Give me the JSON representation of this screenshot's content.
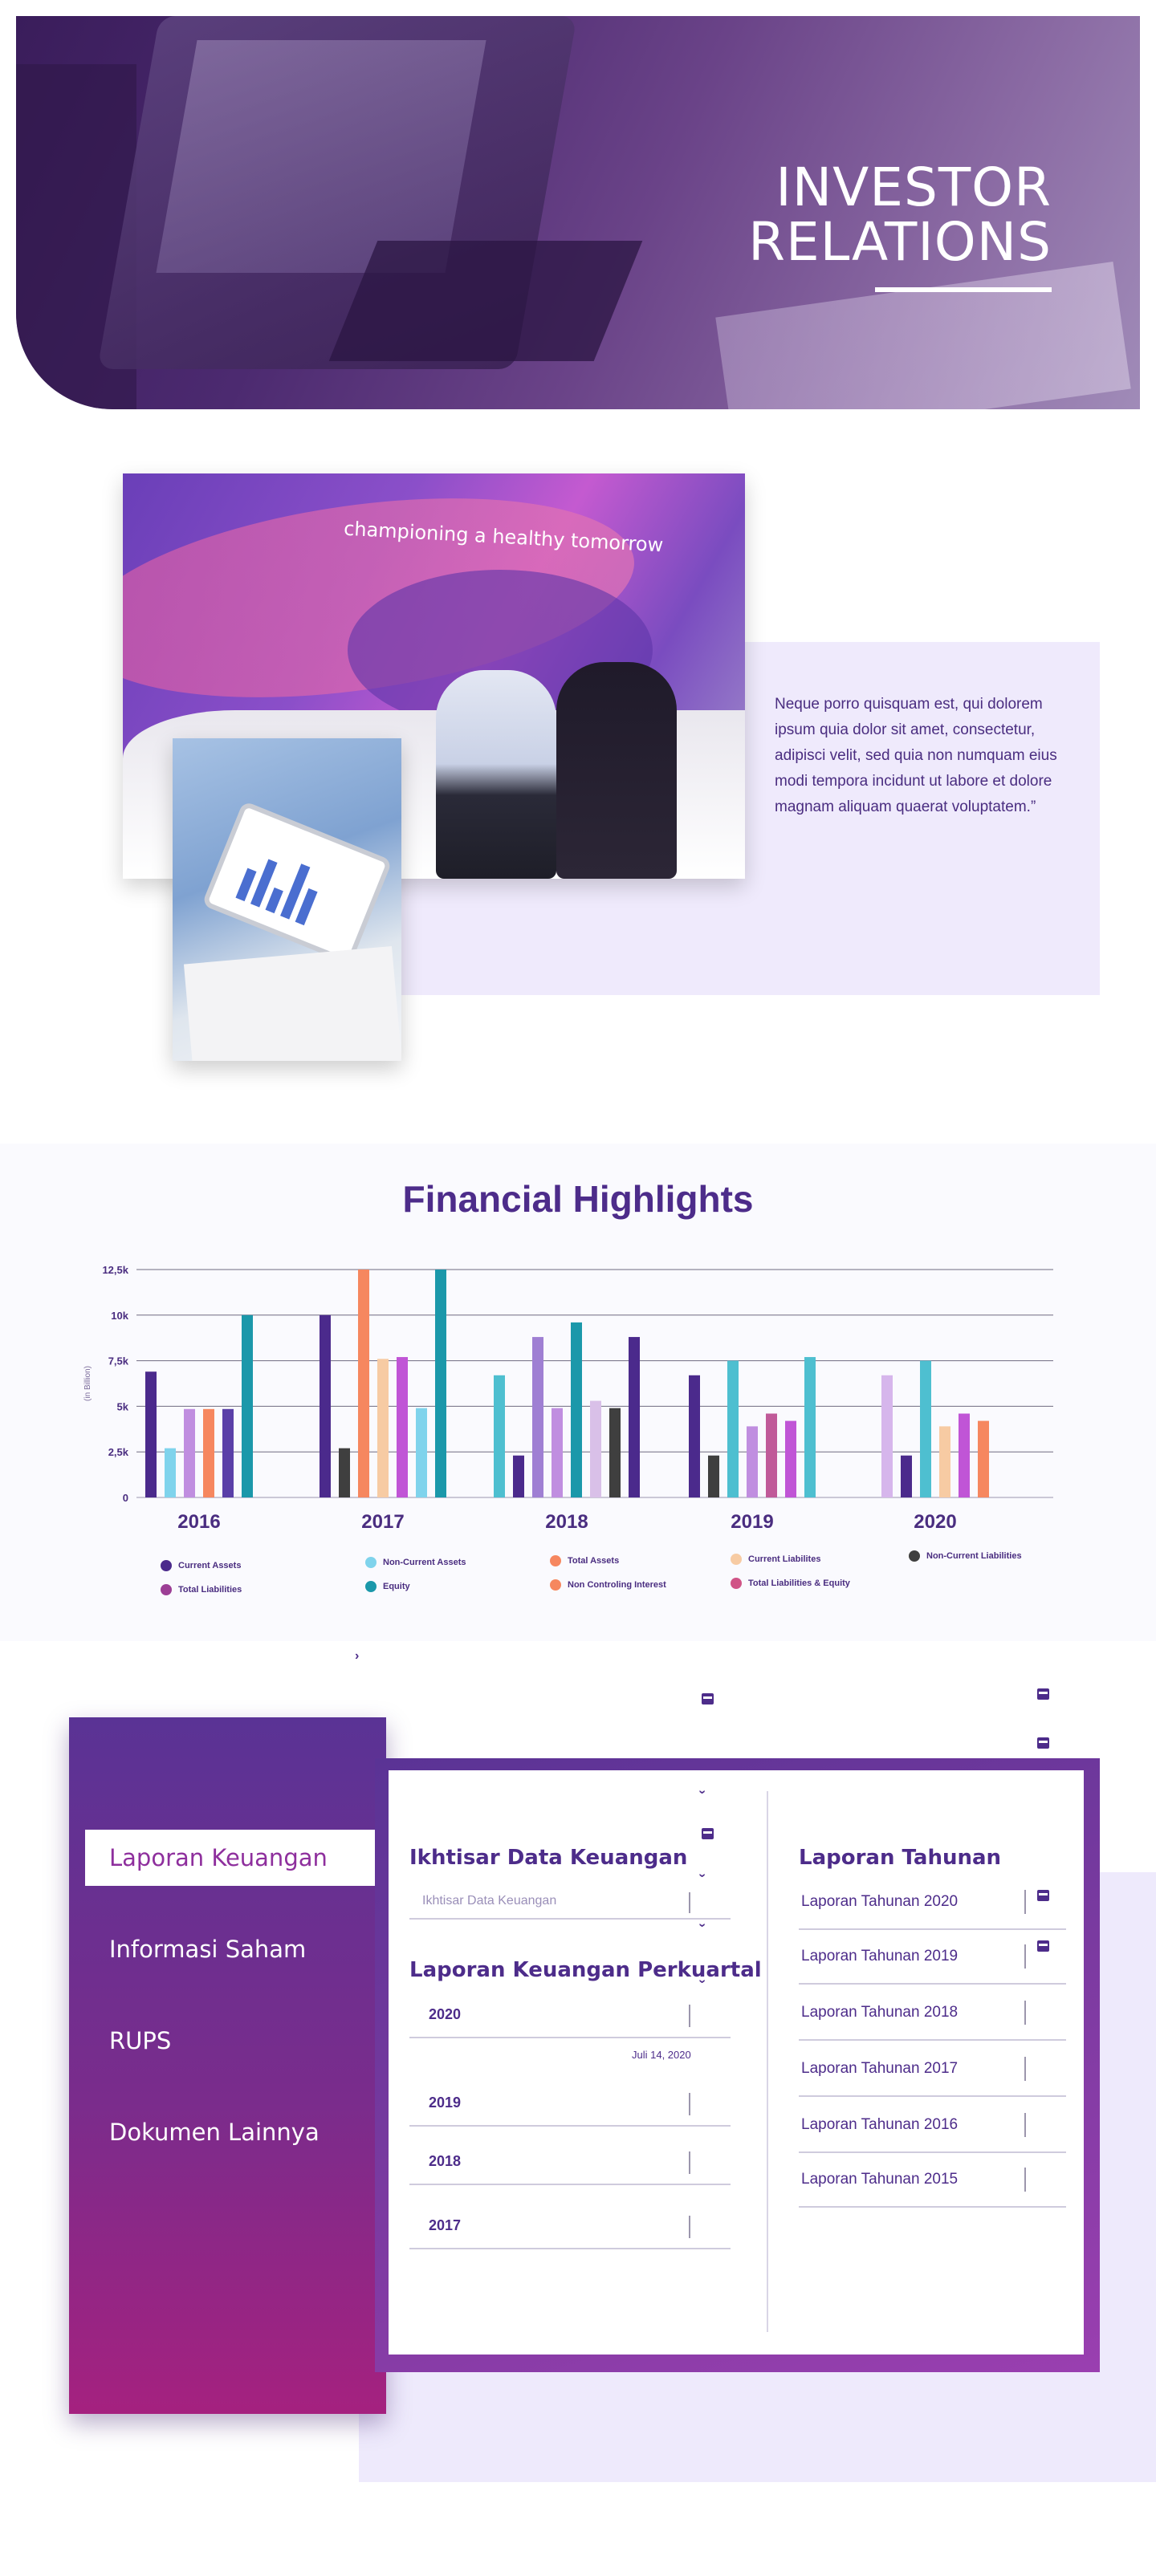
{
  "hero": {
    "title_line1": "INVESTOR",
    "title_line2": "RELATIONS"
  },
  "intro": {
    "photo_tagline": "championing a healthy tomorrow",
    "quote": "Neque porro quisquam est, qui dolorem ipsum quia dolor sit amet, consectetur, adipisci velit, sed quia non numquam eius modi tempora incidunt ut labore et dolore magnam aliquam quaerat voluptatem.”"
  },
  "financial": {
    "title": "Financial Highlights",
    "legend": [
      {
        "label": "Current Assets",
        "color": "#4b2a8c"
      },
      {
        "label": "Non-Current Assets",
        "color": "#7fd3ec"
      },
      {
        "label": "Total Assets",
        "color": "#f6875f"
      },
      {
        "label": "Current Liabilites",
        "color": "#f7cba3"
      },
      {
        "label": "Non-Current Liabilities",
        "color": "#3f3f3f"
      },
      {
        "label": "Total Liabilities",
        "color": "#9c3e95"
      },
      {
        "label": "Equity",
        "color": "#1b98aa"
      },
      {
        "label": "Non Controling Interest",
        "color": "#f6875f"
      },
      {
        "label": "Total Liabilities & Equity",
        "color": "#d05487"
      }
    ]
  },
  "chart_data": {
    "type": "bar",
    "title": "Financial Highlights",
    "ylabel": "(in Billion)",
    "ylim": [
      0,
      12500
    ],
    "yticks": [
      "0",
      "2,5k",
      "5k",
      "7,5k",
      "10k",
      "12,5k"
    ],
    "categories": [
      "2016",
      "2017",
      "2018",
      "2019",
      "2020"
    ],
    "groups": [
      {
        "category": "2016",
        "bars": [
          {
            "color": "#4b2a8c",
            "value": 6900
          },
          {
            "color": "#7fd3ec",
            "value": 2700
          },
          {
            "color": "#c08ee0",
            "value": 4850
          },
          {
            "color": "#f6875f",
            "value": 4850
          },
          {
            "color": "#5a3fa8",
            "value": 4850
          },
          {
            "color": "#1b98aa",
            "value": 10000
          }
        ]
      },
      {
        "category": "2017",
        "bars": [
          {
            "color": "#4b2a8c",
            "value": 10000
          },
          {
            "color": "#3f3f3f",
            "value": 2700
          },
          {
            "color": "#f6875f",
            "value": 12500
          },
          {
            "color": "#f7cba3",
            "value": 7600
          },
          {
            "color": "#c055d6",
            "value": 7700
          },
          {
            "color": "#7fd3ec",
            "value": 4900
          },
          {
            "color": "#1b98aa",
            "value": 12500
          }
        ]
      },
      {
        "category": "2018",
        "bars": [
          {
            "color": "#4ebfd0",
            "value": 6700
          },
          {
            "color": "#4b2a8c",
            "value": 2300
          },
          {
            "color": "#9f7fd3",
            "value": 8800
          },
          {
            "color": "#c08ee0",
            "value": 4900
          },
          {
            "color": "#1b98aa",
            "value": 9600
          },
          {
            "color": "#d9c0e8",
            "value": 5300
          },
          {
            "color": "#3f3f3f",
            "value": 4900
          },
          {
            "color": "#4b2a8c",
            "value": 8800
          }
        ]
      },
      {
        "category": "2019",
        "bars": [
          {
            "color": "#4b2a8c",
            "value": 6700
          },
          {
            "color": "#3f3f3f",
            "value": 2300
          },
          {
            "color": "#4ebfd0",
            "value": 7500
          },
          {
            "color": "#c08ee0",
            "value": 3900
          },
          {
            "color": "#c05a99",
            "value": 4600
          },
          {
            "color": "#c055d6",
            "value": 4200
          },
          {
            "color": "#4ebfd0",
            "value": 7700
          }
        ]
      },
      {
        "category": "2020",
        "bars": [
          {
            "color": "#d6b6ec",
            "value": 6700
          },
          {
            "color": "#4b2a8c",
            "value": 2300
          },
          {
            "color": "#4ebfd0",
            "value": 7500
          },
          {
            "color": "#f7cba3",
            "value": 3900
          },
          {
            "color": "#c055d6",
            "value": 4600
          },
          {
            "color": "#f6875f",
            "value": 4200
          }
        ]
      }
    ]
  },
  "sidebar": {
    "items": [
      {
        "label": "Laporan Keuangan",
        "active": true
      },
      {
        "label": "Informasi Saham",
        "active": false
      },
      {
        "label": "RUPS",
        "active": false
      },
      {
        "label": "Dokumen Lainnya",
        "active": false
      }
    ]
  },
  "panel": {
    "left_title": "Ikhtisar Data Keuangan",
    "select_placeholder": "Ikhtisar Data Keuangan",
    "quarterly_title": "Laporan Keuangan Perkuartal",
    "quarterly_rows": [
      "2020",
      "2019",
      "2018",
      "2017"
    ],
    "quarterly_date": "Juli 14, 2020",
    "right_title": "Laporan Tahunan",
    "annual_rows": [
      "Laporan Tahunan 2020",
      "Laporan Tahunan 2019",
      "Laporan Tahunan 2018",
      "Laporan Tahunan 2017",
      "Laporan Tahunan 2016",
      "Laporan Tahunan 2015"
    ]
  },
  "icons": {
    "chevron": "›",
    "chevron_down": "⌄",
    "pdf": "pdf-icon"
  }
}
